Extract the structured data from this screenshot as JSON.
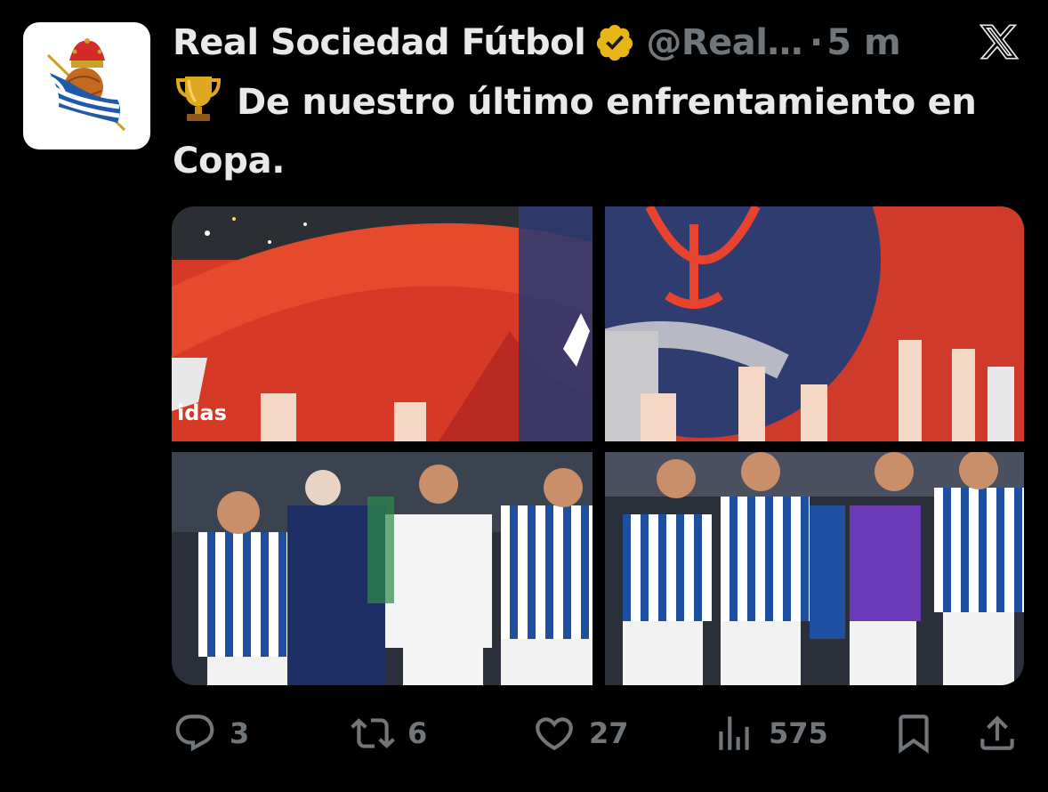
{
  "account": {
    "display_name": "Real Sociedad Fútbol",
    "handle": "@Real…",
    "separator": "·",
    "time": "5 m",
    "verified": true,
    "verified_color": "#e8b518",
    "avatar_icon": "real-sociedad-crest-icon"
  },
  "tweet": {
    "emoji": "trophy-icon",
    "text": "De nuestro último enfrentamiento en Copa."
  },
  "media": {
    "photo_count": 4,
    "description_icon": "team-celebration-photo"
  },
  "actions": {
    "replies": "3",
    "retweets": "6",
    "likes": "27",
    "views": "575"
  },
  "colors": {
    "background": "#000000",
    "text": "#e7e9ea",
    "muted": "#71767b"
  }
}
